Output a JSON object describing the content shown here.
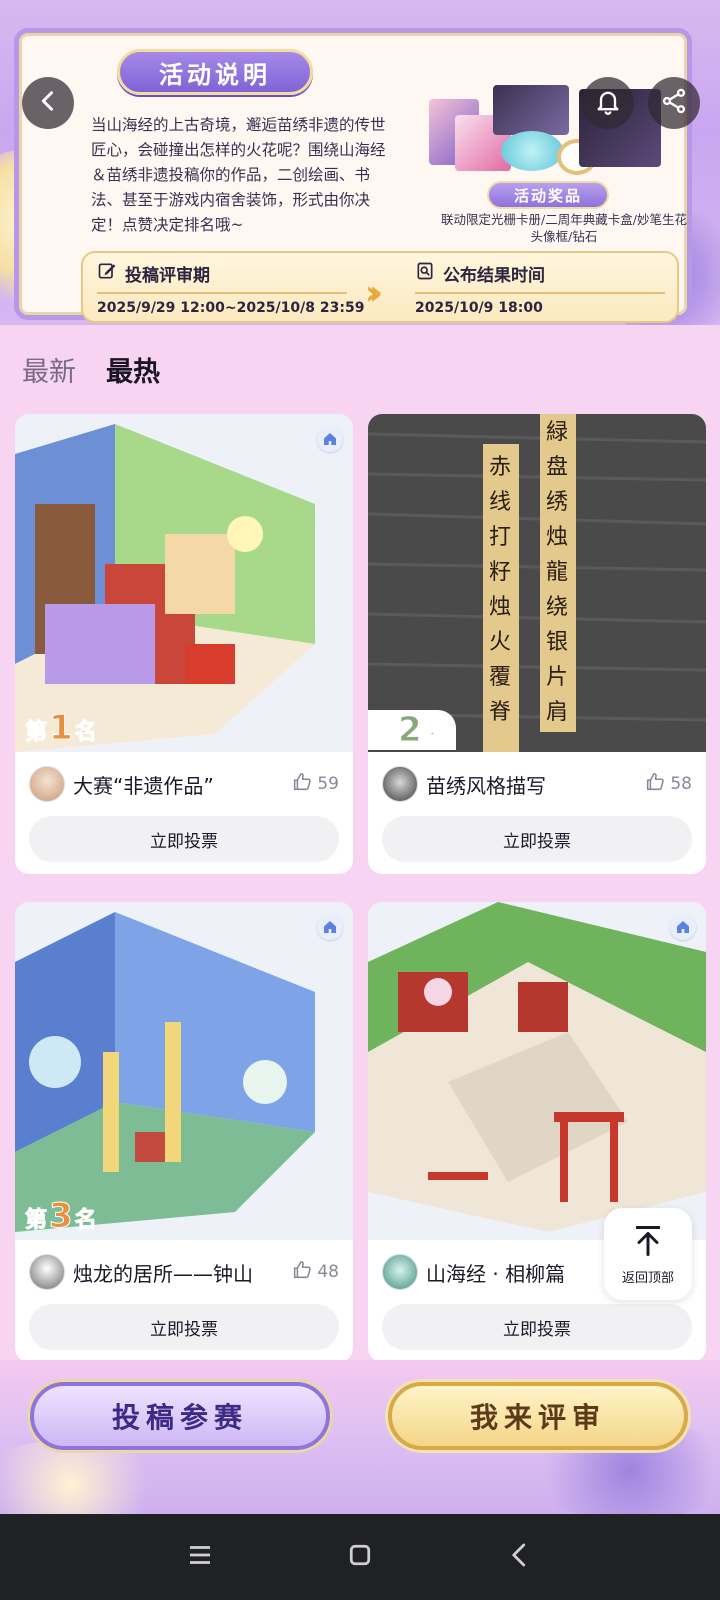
{
  "banner": {
    "title": "活动说明",
    "intro": "当山海经的上古奇境，邂逅苗绣非遗的传世匠心，会碰撞出怎样的火花呢？围绕山海经＆苗绣非遗投稿你的作品，二创绘画、书法、甚至于游戏内宿舍装饰，形式由你决定！点赞决定排名哦~",
    "prize_label": "活动奖品",
    "prize_desc": "联动限定光栅卡册/二周年典藏卡盒/妙笔生花头像框/钻石",
    "schedule": {
      "review_title": "投稿评审期",
      "review_time": "2025/9/29 12:00~2025/10/8 23:59",
      "result_title": "公布结果时间",
      "result_time": "2025/10/9 18:00"
    }
  },
  "tabs": [
    {
      "label": "最新",
      "active": false
    },
    {
      "label": "最热",
      "active": true
    }
  ],
  "cards": [
    {
      "rank_prefix": "第",
      "rank_num": "1",
      "rank_suffix": "名",
      "title": "大赛“非遗作品”",
      "likes": "59",
      "vote_label": "立即投票"
    },
    {
      "rank_prefix": "第",
      "rank_num": "2",
      "rank_suffix": "名",
      "title": "苗绣风格描写",
      "likes": "58",
      "vote_label": "立即投票"
    },
    {
      "rank_prefix": "第",
      "rank_num": "3",
      "rank_suffix": "名",
      "title": "烛龙的居所——钟山",
      "likes": "48",
      "vote_label": "立即投票"
    },
    {
      "title": "山海经 · 相柳篇",
      "vote_label": "立即投票"
    }
  ],
  "back_to_top": "返回顶部",
  "actions": {
    "submit": "投稿参赛",
    "review": "我来评审"
  },
  "colors": {
    "page_bg": "#f7d4f1",
    "accent_purple": "#8f74dd",
    "accent_gold": "#d9a847",
    "rank_gold": "#ea8f3c"
  },
  "icons": {
    "back": "arrow-left-icon",
    "bell": "bell-icon",
    "share": "share-icon",
    "like": "thumbs-up-icon",
    "home": "home-icon",
    "to_top": "arrow-up-icon"
  }
}
